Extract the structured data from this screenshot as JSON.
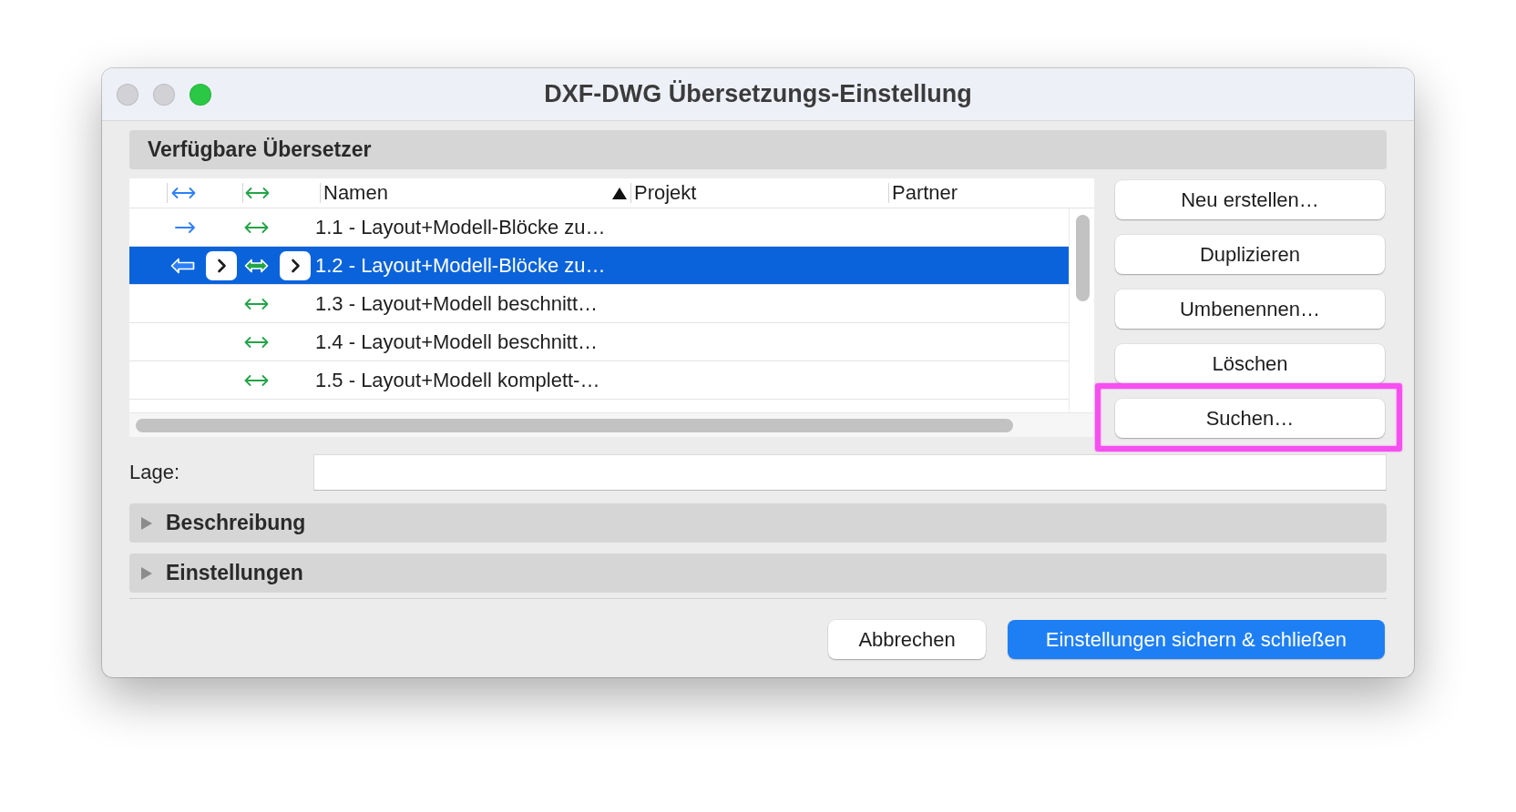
{
  "window": {
    "title": "DXF-DWG Übersetzungs-Einstellung",
    "controls": [
      {
        "kind": "close",
        "enabled": false
      },
      {
        "kind": "minimize",
        "enabled": false
      },
      {
        "kind": "zoom",
        "enabled": true
      }
    ]
  },
  "translators": {
    "title": "Verfügbare Übersetzer",
    "columns": [
      {
        "kind": "arrows",
        "color": "#2d7ff9"
      },
      {
        "kind": "arrows",
        "color": "#22a447"
      },
      {
        "kind": "text",
        "label": "Namen",
        "sorted": true
      },
      {
        "kind": "text",
        "label": "Projekt",
        "sorted": false
      },
      {
        "kind": "text",
        "label": "Partner",
        "sorted": false
      }
    ],
    "rows": [
      {
        "icons": [
          {
            "kind": "right"
          },
          {
            "kind": "both"
          }
        ],
        "name": "1.1 - Layout+Modell-Blöcke zu…",
        "selected": false
      },
      {
        "icons": [
          {
            "kind": "left"
          },
          {
            "kind": "both"
          }
        ],
        "name": "1.2 - Layout+Modell-Blöcke zu…",
        "selected": true
      },
      {
        "icons": [
          {
            "kind": "none"
          },
          {
            "kind": "both"
          }
        ],
        "name": "1.3 - Layout+Modell beschnitt…",
        "selected": false
      },
      {
        "icons": [
          {
            "kind": "none"
          },
          {
            "kind": "both"
          }
        ],
        "name": "1.4 - Layout+Modell beschnitt…",
        "selected": false
      },
      {
        "icons": [
          {
            "kind": "none"
          },
          {
            "kind": "both"
          }
        ],
        "name": "1.5 - Layout+Modell komplett-…",
        "selected": false
      }
    ]
  },
  "side_buttons": [
    {
      "label": "Neu erstellen…",
      "highlighted": false
    },
    {
      "label": "Duplizieren",
      "highlighted": false
    },
    {
      "label": "Umbenennen…",
      "highlighted": false
    },
    {
      "label": "Löschen",
      "highlighted": false
    },
    {
      "label": "Suchen…",
      "highlighted": true
    }
  ],
  "location": {
    "label": "Lage:"
  },
  "sections": [
    {
      "title": "Beschreibung",
      "expanded": false
    },
    {
      "title": "Einstellungen",
      "expanded": false
    }
  ],
  "footer_buttons": [
    {
      "label": "Abbrechen",
      "kind": "secondary"
    },
    {
      "label": "Einstellungen sichern & schließen",
      "kind": "primary"
    }
  ]
}
